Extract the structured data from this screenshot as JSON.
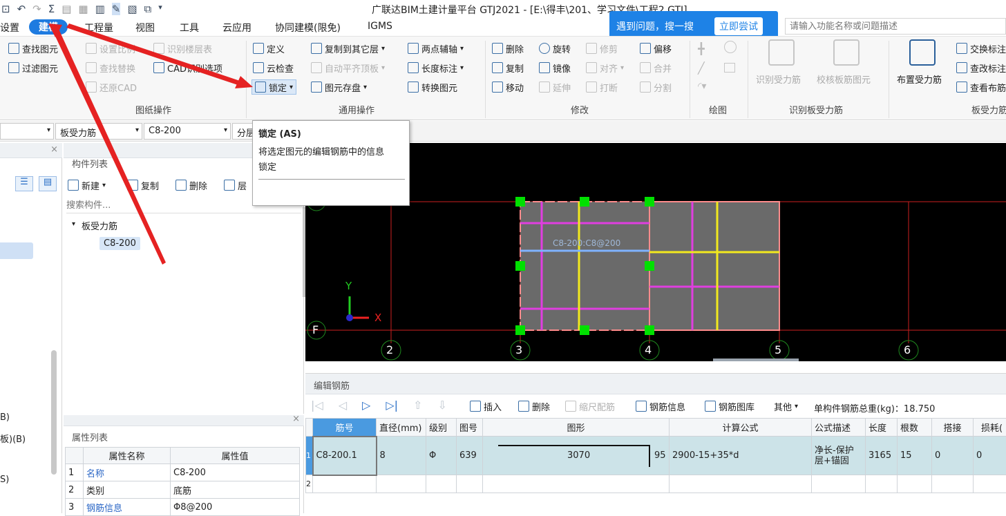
{
  "title_bar": {
    "quick_access": [
      "save-icon",
      "undo-icon",
      "redo-icon",
      "sum-icon",
      "report-icon",
      "grid-icon",
      "rebar-icon",
      "draw-icon",
      "table-icon",
      "copy-icon",
      "dropdown-icon"
    ],
    "title": "广联达BIM土建计量平台 GTJ2021 - [E:\\得丰\\201、学习文件\\工程2.GTJ]"
  },
  "menu": {
    "items": [
      "设置",
      "建模",
      "工程量",
      "视图",
      "工具",
      "云应用",
      "协同建模(限免)",
      "IGMS"
    ],
    "active": "建模"
  },
  "search_banner": {
    "prompt": "遇到问题，搜一搜",
    "button": "立即尝试",
    "placeholder": "请输入功能名称或问题描述"
  },
  "ribbon": {
    "drawing_ops": {
      "items": [
        "查找图元",
        "过滤图元",
        "设置比例",
        "查找替换",
        "还原CAD",
        "识别楼层表",
        "CAD识别选项"
      ],
      "group_label": "图纸操作"
    },
    "general_ops": {
      "items": [
        "定义",
        "复制到其它层",
        "两点辅轴",
        "云检查",
        "自动平齐顶板",
        "长度标注",
        "锁定",
        "图元存盘",
        "转换图元"
      ],
      "group_label": "通用操作"
    },
    "modify": {
      "items": [
        "删除",
        "旋转",
        "修剪",
        "偏移",
        "复制",
        "镜像",
        "对齐",
        "合并",
        "移动",
        "延伸",
        "打断",
        "分割"
      ],
      "group_label": "修改"
    },
    "draw": {
      "group_label": "绘图"
    },
    "identify": {
      "items": [
        "识别受力筋",
        "校核板筋图元"
      ],
      "group_label": "识别板受力筋"
    },
    "slab_rebar": {
      "big_button": "布置受力筋",
      "items": [
        "交换标注",
        "查改标注",
        "查看布筋"
      ],
      "group_label": "板受力筋"
    }
  },
  "tooltip": {
    "title": "锁定 (AS)",
    "body_line1": "将选定图元的编辑钢筋中的信息",
    "body_line2": "锁定"
  },
  "combos": {
    "type": "板受力筋",
    "element": "C8-200",
    "layer": "分层"
  },
  "left_panel": {
    "items": [
      "B)",
      "板)(B)",
      "S)"
    ]
  },
  "component_list": {
    "header": "构件列表",
    "toolbar": [
      "新建",
      "复制",
      "删除",
      "层"
    ],
    "search_placeholder": "搜索构件...",
    "tree_group": "板受力筋",
    "tree_item": "C8-200"
  },
  "property_list": {
    "header": "属性列表",
    "col_name": "属性名称",
    "col_value": "属性值",
    "rows": [
      {
        "no": "1",
        "name": "名称",
        "value": "C8-200"
      },
      {
        "no": "2",
        "name": "类别",
        "value": "底筋"
      },
      {
        "no": "3",
        "name": "钢筋信息",
        "value": "Φ8@200"
      }
    ]
  },
  "cad": {
    "axis_bottom": [
      "2",
      "3",
      "4",
      "5",
      "6"
    ],
    "axis_left": "F",
    "rebar_label": "C8-200:C8@200",
    "ucs_x": "X",
    "ucs_y": "Y",
    "colors": {
      "bg": "#000000",
      "grid": "#cc1f1f",
      "slab": "#6a6a6a",
      "magenta": "#e03ee0",
      "yellow": "#f2e91e",
      "grip": "#00e000",
      "blue": "#7fb2ff"
    }
  },
  "rebar_editor": {
    "header": "编辑钢筋",
    "toolbar": [
      "插入",
      "删除",
      "缩尺配筋",
      "钢筋信息",
      "钢筋图库",
      "其他"
    ],
    "total_weight": "单构件钢筋总重(kg)：18.750",
    "columns": [
      "筋号",
      "直径(mm)",
      "级别",
      "图号",
      "图形",
      "计算公式",
      "公式描述",
      "长度",
      "根数",
      "搭接",
      "损耗("
    ],
    "rows": [
      {
        "idx": "1",
        "bar": "C8-200.1",
        "dia": "8",
        "grade": "Φ",
        "fig": "639",
        "shape_len": "3070",
        "shape_end": "95",
        "formula": "2900-15+35*d",
        "desc": "净长-保护层+锚固",
        "length": "3165",
        "count": "15",
        "lap": "0",
        "loss": "0"
      },
      {
        "idx": "2"
      }
    ]
  }
}
